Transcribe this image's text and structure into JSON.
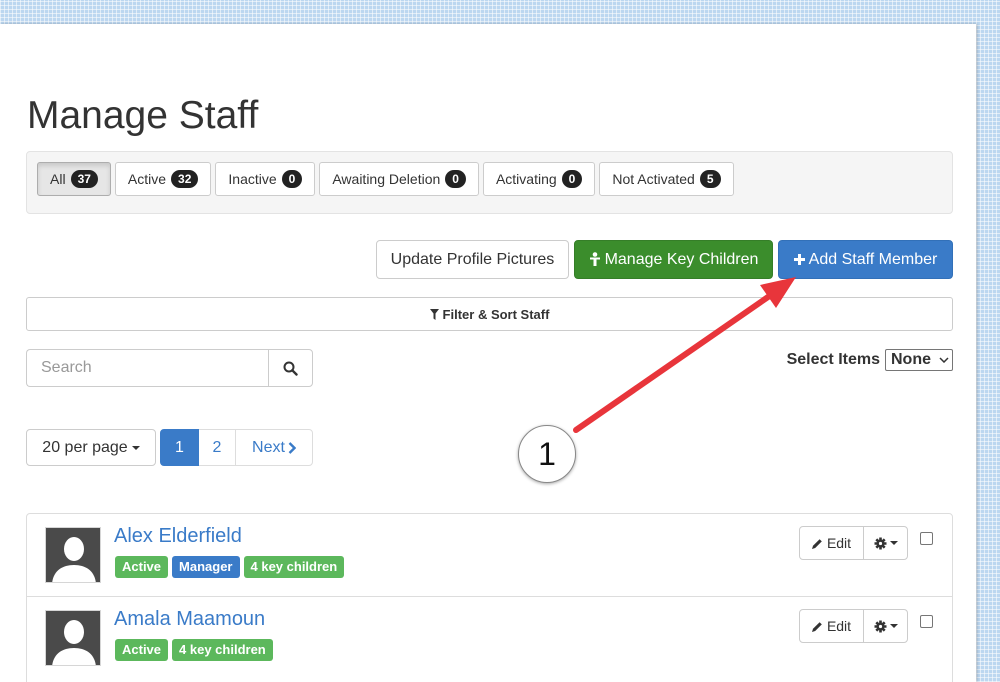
{
  "page": {
    "title": "Manage Staff"
  },
  "tabs": [
    {
      "label": "All",
      "count": "37"
    },
    {
      "label": "Active",
      "count": "32"
    },
    {
      "label": "Inactive",
      "count": "0"
    },
    {
      "label": "Awaiting Deletion",
      "count": "0"
    },
    {
      "label": "Activating",
      "count": "0"
    },
    {
      "label": "Not Activated",
      "count": "5"
    }
  ],
  "actions": {
    "update_pictures": "Update Profile Pictures",
    "manage_key_children": "Manage Key Children",
    "add_staff": "Add Staff Member"
  },
  "filter": {
    "label": "Filter & Sort Staff"
  },
  "search": {
    "placeholder": "Search"
  },
  "select_items": {
    "label": "Select Items",
    "value": "None"
  },
  "pagination": {
    "per_page": "20 per page",
    "pages": [
      "1",
      "2"
    ],
    "next": "Next",
    "current": "1"
  },
  "staff": [
    {
      "name": "Alex Elderfield",
      "labels": [
        {
          "text": "Active",
          "color": "#5cb85c"
        },
        {
          "text": "Manager",
          "color": "#3a7bc8"
        },
        {
          "text": "4 key children",
          "color": "#5cb85c"
        }
      ],
      "edit": "Edit"
    },
    {
      "name": "Amala Maamoun",
      "labels": [
        {
          "text": "Active",
          "color": "#5cb85c"
        },
        {
          "text": "4 key children",
          "color": "#5cb85c"
        }
      ],
      "edit": "Edit"
    }
  ],
  "annotation": {
    "number": "1"
  },
  "colors": {
    "primary": "#3a7bc8",
    "success": "#3b8d2c",
    "label_green": "#5cb85c",
    "arrow": "#e8353b"
  }
}
